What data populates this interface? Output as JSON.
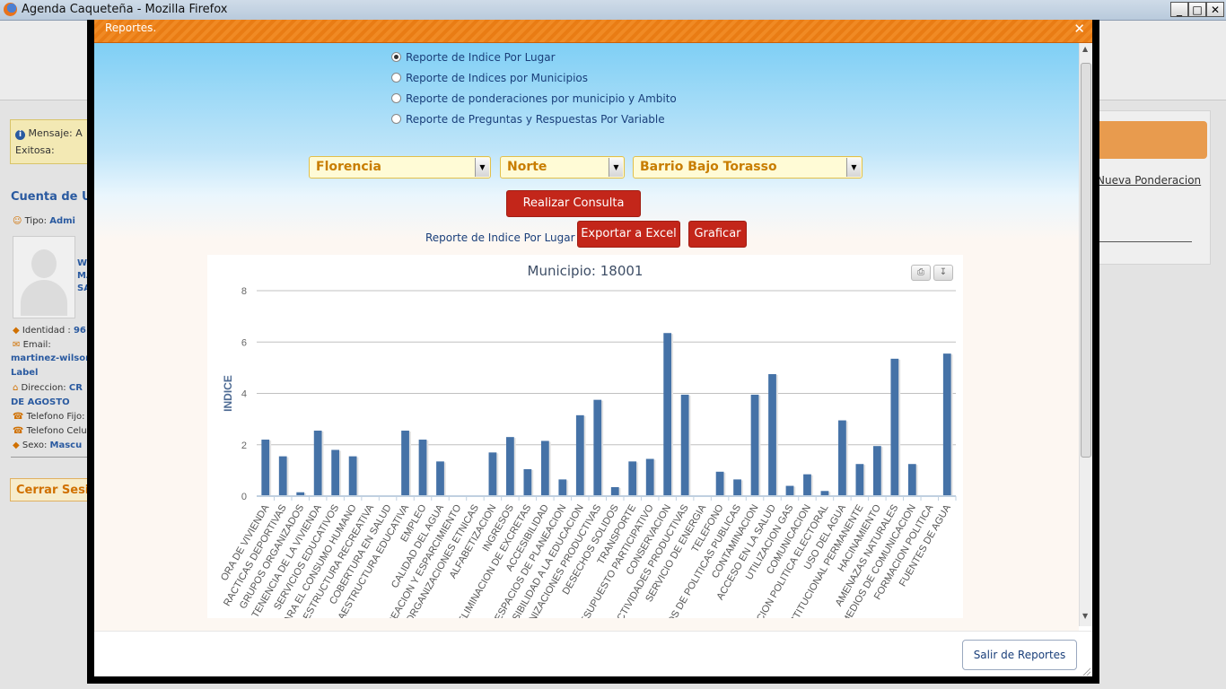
{
  "window": {
    "title": "Agenda Caqueteña - Mozilla Firefox",
    "min": "_",
    "max": "□",
    "close": "✕"
  },
  "background": {
    "message_label": "Mensaje:",
    "message_value": "A",
    "message_line2": "Exitosa:",
    "cuenta": "Cuenta de Us",
    "tipo_label": "Tipo:",
    "tipo_value": "Admi",
    "name_lines": [
      "WI",
      "MA",
      "SA"
    ],
    "identidad_label": "Identidad :",
    "identidad_value": "96",
    "email_label": "Email:",
    "email_value": "martinez-wilson",
    "email_value2": "Label",
    "direccion_label": "Direccion:",
    "direccion_value": "CR",
    "direccion_value2": "DE AGOSTO",
    "telefono_fijo_label": "Telefono Fijo:",
    "telefono_celu_label": "Telefono Celu",
    "sexo_label": "Sexo:",
    "sexo_value": "Mascu",
    "cerrar": "Cerrar Sesi",
    "nueva_ponderacion": "Nueva Ponderacion"
  },
  "modal": {
    "title": "Reportes.",
    "close": "✕",
    "radios": [
      {
        "label": "Reporte de Indice Por Lugar",
        "checked": true
      },
      {
        "label": "Reporte de Indices por Municipios",
        "checked": false
      },
      {
        "label": "Reporte de ponderaciones por municipio y Ambito",
        "checked": false
      },
      {
        "label": "Reporte de Preguntas y Respuestas Por Variable",
        "checked": false
      }
    ],
    "selects": {
      "municipio": "Florencia",
      "zona": "Norte",
      "barrio": "Barrio Bajo Torasso"
    },
    "realizar": "Realizar Consulta",
    "report_label": "Reporte de Indice Por Lugar",
    "exportar": "Exportar a Excel",
    "graficar": "Graficar",
    "salir": "Salir de Reportes"
  },
  "chart_data": {
    "type": "bar",
    "title": "Municipio: 18001",
    "ylabel": "INDICE",
    "xlabel": "",
    "ylim": [
      0,
      8
    ],
    "yticks": [
      0,
      2,
      4,
      6,
      8
    ],
    "grid": true,
    "color": "#4572a7",
    "categories": [
      "CALIDAD DE VIVIENDA",
      "PRACTICAS DEPORTIVAS",
      "GRUPOS ORGANIZADOS",
      "TENENCIA DE LA VIVIENDA",
      "SERVICIOS EDUCATIVOS",
      "AGUA PARA EL CONSUMO HUMANO",
      "INFRAESTRUCTURA RECREATIVA",
      "COBERTURA EN SALUD",
      "INFRAESTRUCTURA EDUCATIVA",
      "EMPLEO",
      "CALIDAD DEL AGUA",
      "RECREACION Y ESPARCIMIENTO",
      "ORGANIZACIONES ETNICAS",
      "ALFABETIZACION",
      "INGRESOS",
      "ELIMINACION DE EXCRETAS",
      "ACCESIBILIDAD",
      "ESPACIOS DE PLANEACION",
      "ACCESIBILIDAD A LA EDUCACION",
      "ORGANIZACIONES PRODUCTIVAS",
      "DESECHOS SOLIDOS",
      "TRANSPORTE",
      "PRESUPUESTO PARTICIPATIVO",
      "CONSERVACION",
      "ACTIVIDADES PRODUCTIVAS",
      "SERVICIO DE ENERGIA",
      "TELEFONO",
      "PROCESOS DE POLITICAS PUBLICAS",
      "CONTAMINACION",
      "ACCESO EN LA SALUD",
      "UTILIZACION GAS",
      "COMUNICACION",
      "PARTICIPACION POLITICA ELECTORAL",
      "USO DEL AGUA",
      "INSTITUCIONAL PERMANENTE",
      "HACINAMIENTO",
      "AMENAZAS NATURALES",
      "MEDIOS DE COMUNICACION",
      "FORMACION POLITICA",
      "FUENTES DE AGUA"
    ],
    "tick_labels": [
      "ORA DE VIVIENDA",
      "RACTICAS DEPORTIVAS",
      "GRUPOS ORGANIZADOS",
      "TENENCIA DE LA VIVIENDA",
      "SERVICIOS EDUCATIVOS",
      "PARA EL CONSUMO HUMANO",
      "RAESTRUCTURA RECREATIVA",
      "COBERTURA EN SALUD",
      "RAESTRUCTURA EDUCATIVA",
      "EMPLEO",
      "CALIDAD DEL AGUA",
      "REACION Y ESPARCIMIENTO",
      "ORGANIZACIONES ETNICAS",
      "ALFABETIZACION",
      "INGRESOS",
      "ELIMINACION DE EXCRETAS",
      "ACCESIBILIDAD",
      "ESPACIOS DE PLANEACION",
      "ESIBILIDAD A LA EDUCACION",
      "ANIZACIONES PRODUCTIVAS",
      "DESECHOS SOLIDOS",
      "TRANSPORTE",
      "ESUPUESTO PARTICIPATIVO",
      "CONSERVACION",
      "ACTIVIDADES PRODUCTIVAS",
      "SERVICIO DE ENERGIA",
      "TELEFONO",
      "OS DE POLITICAS PUBLICAS",
      "CONTAMINACION",
      "ACCESO EN LA SALUD",
      "UTILIZACION GAS",
      "COMUNICACION",
      "ACION POLITICA ELECTORAL",
      "USO DEL AGUA",
      "INSTITUCIONAL PERMANENTE",
      "HACINAMIENTO",
      "AMENAZAS NATURALES",
      "MEDIOS DE COMUNICACION",
      "FORMACION POLITICA",
      "FUENTES DE AGUA"
    ],
    "values": [
      2.2,
      1.55,
      0.15,
      2.55,
      1.8,
      1.55,
      0,
      0,
      2.55,
      2.2,
      1.35,
      0,
      0,
      1.7,
      2.3,
      1.05,
      2.15,
      0.65,
      3.15,
      3.75,
      0.35,
      1.35,
      1.45,
      6.35,
      3.95,
      0,
      0.95,
      0.65,
      3.95,
      4.75,
      0.4,
      0.85,
      0.2,
      2.95,
      1.25,
      1.95,
      5.35,
      1.25,
      0,
      5.55
    ]
  }
}
